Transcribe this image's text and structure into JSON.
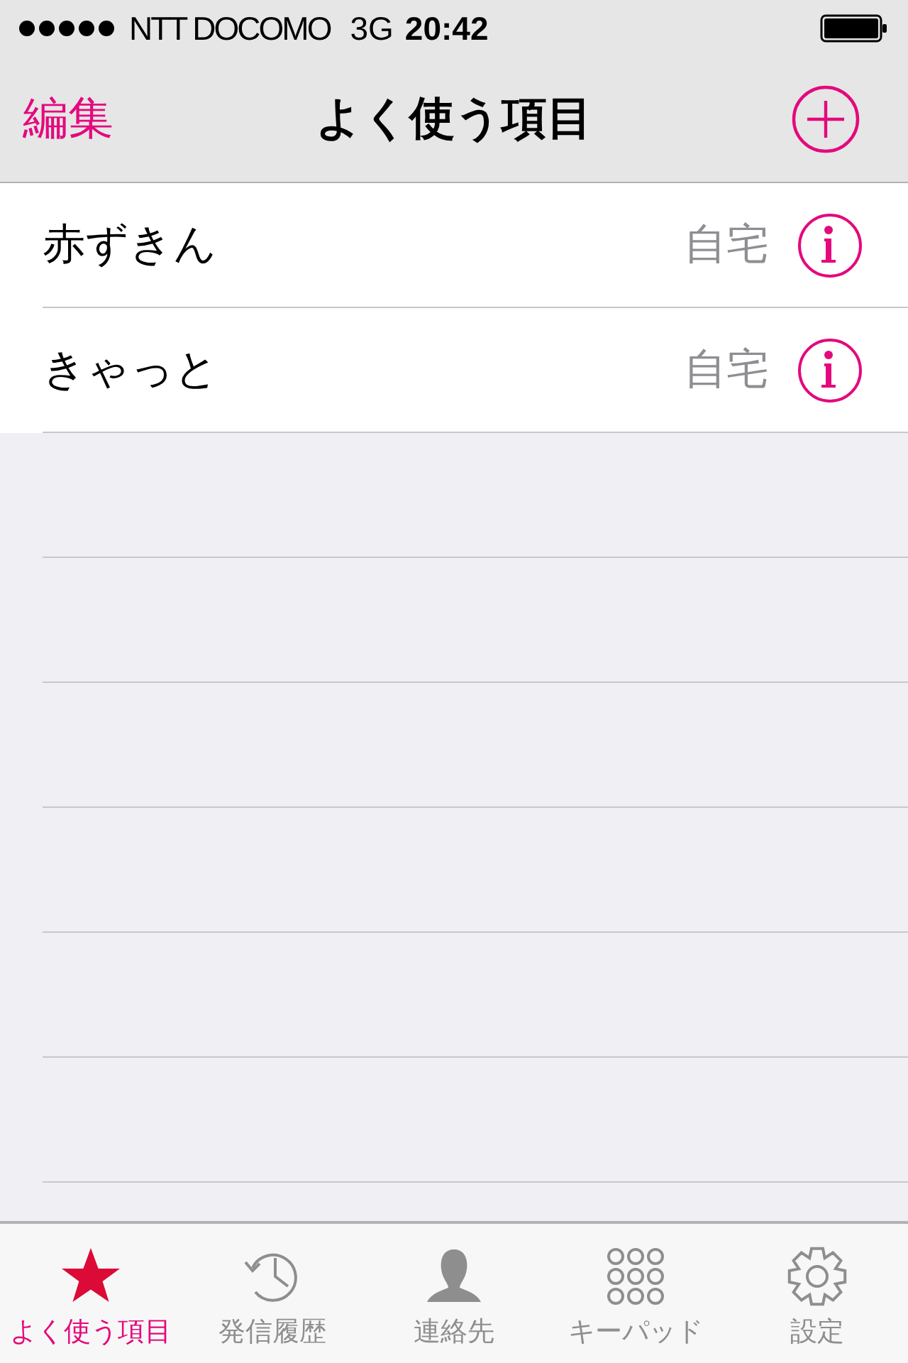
{
  "status_bar": {
    "carrier": "NTT DOCOMO",
    "network": "3G",
    "time": "20:42"
  },
  "nav_bar": {
    "edit": "編集",
    "title": "よく使う項目"
  },
  "favorites": [
    {
      "name": "赤ずきん",
      "label": "自宅"
    },
    {
      "name": "きゃっと",
      "label": "自宅"
    }
  ],
  "tab_bar": [
    {
      "kind": "star",
      "label": "よく使う項目",
      "selected": true
    },
    {
      "kind": "clock",
      "label": "発信履歴",
      "selected": false
    },
    {
      "kind": "person",
      "label": "連絡先",
      "selected": false
    },
    {
      "kind": "keypad",
      "label": "キーパッド",
      "selected": false
    },
    {
      "kind": "gear",
      "label": "設定",
      "selected": false
    }
  ]
}
